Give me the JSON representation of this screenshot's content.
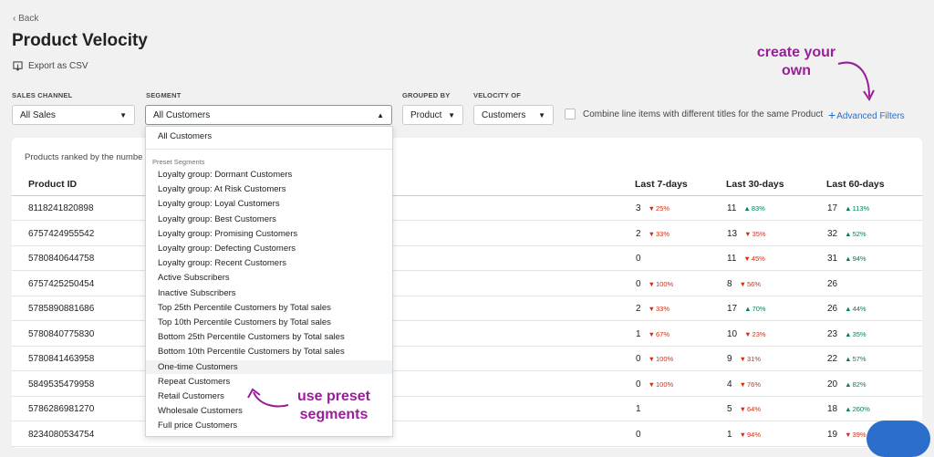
{
  "header": {
    "back_label": "Back",
    "title": "Product Velocity",
    "export_label": "Export as CSV"
  },
  "filters": {
    "sales_channel": {
      "label": "SALES CHANNEL",
      "value": "All Sales"
    },
    "segment": {
      "label": "SEGMENT",
      "value": "All Customers"
    },
    "grouped_by": {
      "label": "GROUPED BY",
      "value": "Product"
    },
    "velocity_of": {
      "label": "VELOCITY OF",
      "value": "Customers"
    },
    "combine_label": "Combine line items with different titles for the same Product",
    "advanced_label": "Advanced Filters"
  },
  "annotations": {
    "create_line1": "create your",
    "create_line2": "own",
    "preset_line1": "use preset",
    "preset_line2": "segments"
  },
  "colors": {
    "annotation": "#9a1e9a",
    "link": "#2c6ecb",
    "down": "#d72c0d",
    "up": "#008060"
  },
  "table": {
    "description": "Products ranked by the numbe",
    "headers": {
      "product_id": "Product ID",
      "d7": "Last 7-days",
      "d30": "Last 30-days",
      "d60": "Last 60-days"
    },
    "rows": [
      {
        "id": "8118241820898",
        "d7": "3",
        "d7c": "25%",
        "d7t": "dn",
        "d30": "11",
        "d30c": "83%",
        "d30t": "up",
        "d60": "17",
        "d60c": "113%",
        "d60t": "up"
      },
      {
        "id": "6757424955542",
        "d7": "2",
        "d7c": "33%",
        "d7t": "dn",
        "d30": "13",
        "d30c": "35%",
        "d30t": "dn",
        "d60": "32",
        "d60c": "52%",
        "d60t": "up"
      },
      {
        "id": "5780840644758",
        "d7": "0",
        "d7c": "",
        "d7t": "",
        "d30": "11",
        "d30c": "45%",
        "d30t": "dn",
        "d60": "31",
        "d60c": "94%",
        "d60t": "up"
      },
      {
        "id": "6757425250454",
        "d7": "0",
        "d7c": "100%",
        "d7t": "dn",
        "d30": "8",
        "d30c": "56%",
        "d30t": "dn",
        "d60": "26",
        "d60c": "",
        "d60t": ""
      },
      {
        "id": "5785890881686",
        "d7": "2",
        "d7c": "33%",
        "d7t": "dn",
        "d30": "17",
        "d30c": "70%",
        "d30t": "up",
        "d60": "26",
        "d60c": "44%",
        "d60t": "up"
      },
      {
        "id": "5780840775830",
        "d7": "1",
        "d7c": "67%",
        "d7t": "dn",
        "d30": "10",
        "d30c": "23%",
        "d30t": "dn",
        "d60": "23",
        "d60c": "35%",
        "d60t": "up"
      },
      {
        "id": "5780841463958",
        "d7": "0",
        "d7c": "100%",
        "d7t": "dn",
        "d30": "9",
        "d30c": "31%",
        "d30t": "dn",
        "d60": "22",
        "d60c": "57%",
        "d60t": "up"
      },
      {
        "id": "5849535479958",
        "d7": "0",
        "d7c": "100%",
        "d7t": "dn",
        "d30": "4",
        "d30c": "76%",
        "d30t": "dn",
        "d60": "20",
        "d60c": "82%",
        "d60t": "up"
      },
      {
        "id": "5786286981270",
        "d7": "1",
        "d7c": "",
        "d7t": "",
        "d30": "5",
        "d30c": "64%",
        "d30t": "dn",
        "d60": "18",
        "d60c": "260%",
        "d60t": "up"
      },
      {
        "id": "8234080534754",
        "d7": "0",
        "d7c": "",
        "d7t": "",
        "d30": "1",
        "d30c": "94%",
        "d30t": "dn",
        "d60": "19",
        "d60c": "39%",
        "d60t": "dn"
      }
    ]
  },
  "dropdown": {
    "selected": "All Customers",
    "group_label": "Preset Segments",
    "highlighted": "One-time Customers",
    "options": [
      "Loyalty group: Dormant Customers",
      "Loyalty group: At Risk Customers",
      "Loyalty group: Loyal Customers",
      "Loyalty group: Best Customers",
      "Loyalty group: Promising Customers",
      "Loyalty group: Defecting Customers",
      "Loyalty group: Recent Customers",
      "Active Subscribers",
      "Inactive Subscribers",
      "Top 25th Percentile Customers by Total sales",
      "Top 10th Percentile Customers by Total sales",
      "Bottom 25th Percentile Customers by Total sales",
      "Bottom 10th Percentile Customers by Total sales",
      "One-time Customers",
      "Repeat Customers",
      "Retail Customers",
      "Wholesale Customers",
      "Full price Customers"
    ]
  }
}
